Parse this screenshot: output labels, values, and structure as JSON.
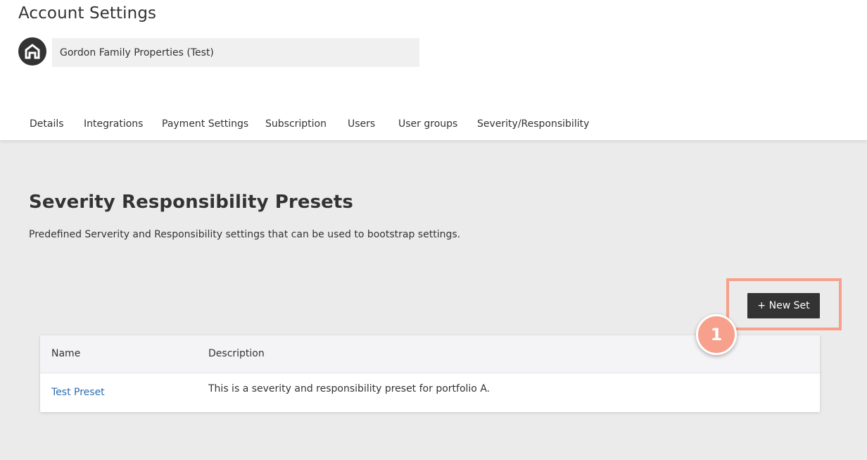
{
  "header": {
    "title": "Account Settings",
    "account_name": "Gordon Family Properties (Test)",
    "avatar_icon": "home-logo-icon"
  },
  "tabs": [
    {
      "label": "Details"
    },
    {
      "label": "Integrations"
    },
    {
      "label": "Payment Settings"
    },
    {
      "label": "Subscription"
    },
    {
      "label": "Users"
    },
    {
      "label": "User groups"
    },
    {
      "label": "Severity/Responsibility"
    }
  ],
  "section": {
    "title": "Severity Responsibility Presets",
    "description": "Predefined Serverity and Responsibility settings that can be used to bootstrap settings."
  },
  "actions": {
    "new_set_label": "+ New Set"
  },
  "table": {
    "columns": [
      "Name",
      "Description"
    ],
    "rows": [
      {
        "name": "Test Preset",
        "description": "This is a severity and responsibility preset for portfolio A."
      }
    ]
  },
  "annotation": {
    "step_number": "1",
    "highlight_color": "#f7a08c"
  }
}
